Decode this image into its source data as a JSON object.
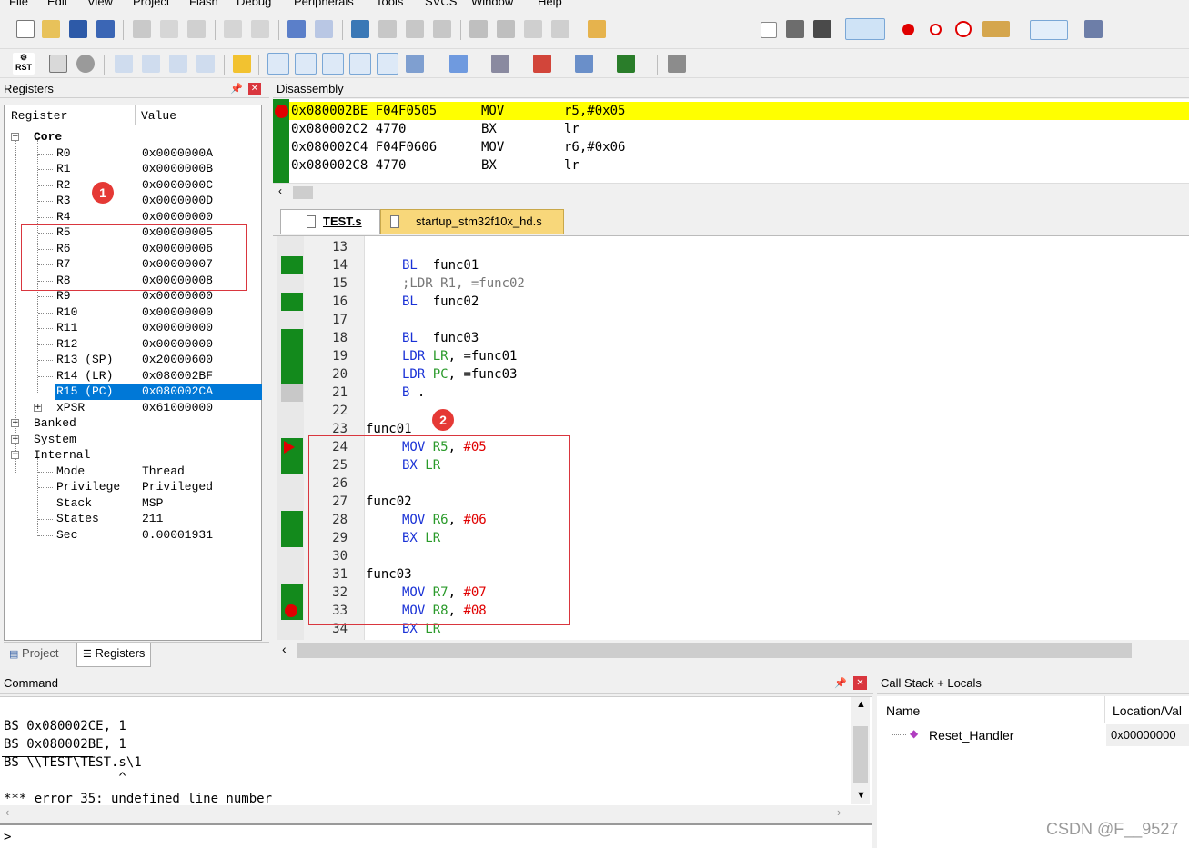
{
  "menu": [
    "File",
    "Edit",
    "View",
    "Project",
    "Flash",
    "Debug",
    "Peripherals",
    "Tools",
    "SVCS",
    "Window",
    "Help"
  ],
  "registers_panel": {
    "title": "Registers",
    "col_register": "Register",
    "col_value": "Value",
    "core_label": "Core",
    "rows": [
      {
        "name": "R0",
        "value": "0x0000000A"
      },
      {
        "name": "R1",
        "value": "0x0000000B"
      },
      {
        "name": "R2",
        "value": "0x0000000C"
      },
      {
        "name": "R3",
        "value": "0x0000000D"
      },
      {
        "name": "R4",
        "value": "0x00000000"
      },
      {
        "name": "R5",
        "value": "0x00000005"
      },
      {
        "name": "R6",
        "value": "0x00000006"
      },
      {
        "name": "R7",
        "value": "0x00000007"
      },
      {
        "name": "R8",
        "value": "0x00000008"
      },
      {
        "name": "R9",
        "value": "0x00000000"
      },
      {
        "name": "R10",
        "value": "0x00000000"
      },
      {
        "name": "R11",
        "value": "0x00000000"
      },
      {
        "name": "R12",
        "value": "0x00000000"
      },
      {
        "name": "R13 (SP)",
        "value": "0x20000600"
      },
      {
        "name": "R14 (LR)",
        "value": "0x080002BF"
      },
      {
        "name": "R15 (PC)",
        "value": "0x080002CA"
      },
      {
        "name": "xPSR",
        "value": "0x61000000"
      }
    ],
    "groups": [
      "Banked",
      "System",
      "Internal"
    ],
    "internal_rows": [
      {
        "name": "Mode",
        "value": "Thread"
      },
      {
        "name": "Privilege",
        "value": "Privileged"
      },
      {
        "name": "Stack",
        "value": "MSP"
      },
      {
        "name": "States",
        "value": "211"
      },
      {
        "name": "Sec",
        "value": "0.00001931"
      }
    ],
    "tab_project": "Project",
    "tab_registers": "Registers",
    "badge": "1"
  },
  "disassembly": {
    "title": "Disassembly",
    "lines": [
      {
        "addr": "0x080002BE",
        "op": "F04F0505",
        "mn": "MOV",
        "args": "r5,#0x05"
      },
      {
        "addr": "0x080002C2",
        "op": "4770",
        "mn": "BX",
        "args": "lr"
      },
      {
        "addr": "0x080002C4",
        "op": "F04F0606",
        "mn": "MOV",
        "args": "r6,#0x06"
      },
      {
        "addr": "0x080002C8",
        "op": "4770",
        "mn": "BX",
        "args": "lr"
      }
    ]
  },
  "editor": {
    "tabs": [
      "TEST.s",
      "startup_stm32f10x_hd.s"
    ],
    "badge": "2",
    "lines": [
      {
        "n": "13",
        "t": ""
      },
      {
        "n": "14",
        "t": "BL  func01"
      },
      {
        "n": "15",
        "t": ";LDR R1, =func02"
      },
      {
        "n": "16",
        "t": "BL  func02"
      },
      {
        "n": "17",
        "t": ""
      },
      {
        "n": "18",
        "t": "BL  func03"
      },
      {
        "n": "19",
        "t": "LDR LR, =func01"
      },
      {
        "n": "20",
        "t": "LDR PC, =func03"
      },
      {
        "n": "21",
        "t": "B ."
      },
      {
        "n": "22",
        "t": ""
      },
      {
        "n": "23",
        "t": "func01"
      },
      {
        "n": "24",
        "t": "MOV R5, #05"
      },
      {
        "n": "25",
        "t": "BX LR"
      },
      {
        "n": "26",
        "t": ""
      },
      {
        "n": "27",
        "t": "func02"
      },
      {
        "n": "28",
        "t": "MOV R6, #06"
      },
      {
        "n": "29",
        "t": "BX LR"
      },
      {
        "n": "30",
        "t": ""
      },
      {
        "n": "31",
        "t": "func03"
      },
      {
        "n": "32",
        "t": "MOV R7, #07"
      },
      {
        "n": "33",
        "t": "MOV R8, #08"
      },
      {
        "n": "34",
        "t": "BX LR"
      }
    ]
  },
  "command": {
    "title": "Command",
    "lines": [
      "BS 0x080002CE, 1",
      "BS 0x080002BE, 1",
      "BS \\\\TEST\\TEST.s\\1",
      "               ^",
      "*** error 35: undefined line number"
    ],
    "prompt": ">"
  },
  "callstack": {
    "title": "Call Stack + Locals",
    "col_name": "Name",
    "col_location": "Location/Val",
    "row_name": "Reset_Handler",
    "row_value": "0x00000000"
  },
  "watermark": "CSDN @F__9527",
  "colors": {
    "accent": "#0078d7",
    "current_line": "#ffff00",
    "gutter_green": "#138a1c",
    "highlight_box": "#d9363e",
    "breakpoint": "#e00000"
  }
}
